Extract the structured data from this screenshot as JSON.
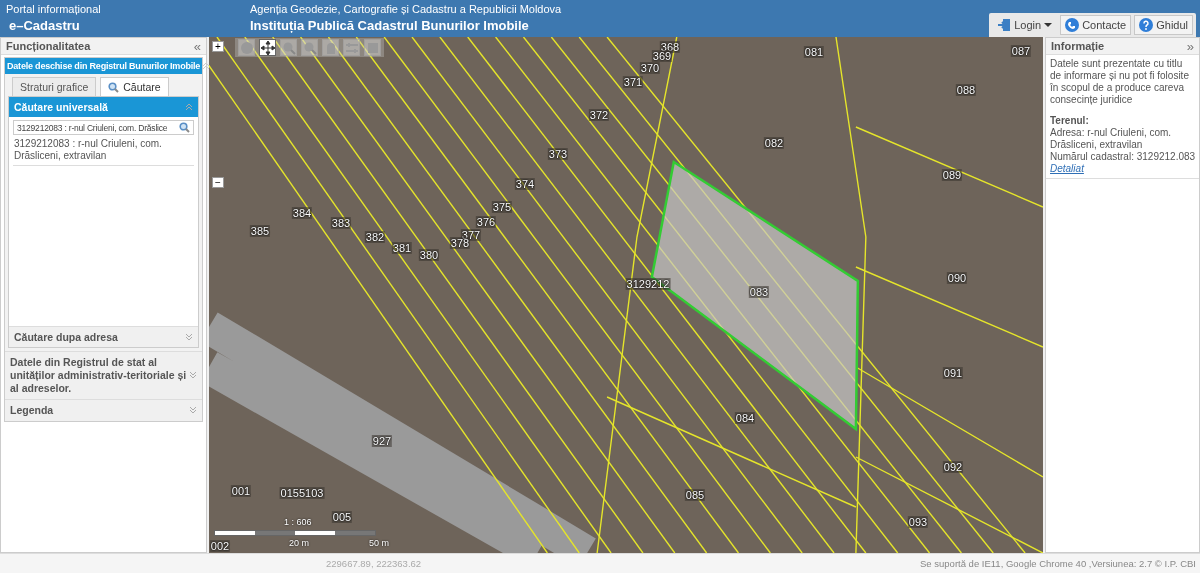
{
  "header": {
    "portal": "Portal informațional",
    "app_name": "e–Cadastru",
    "agency": "Agenția Geodezie, Cartografie și Cadastru a Republicii Moldova",
    "institution": "Instituția Publică Cadastrul Bunurilor Imobile"
  },
  "top_buttons": [
    {
      "label": "Login",
      "kind": "login"
    },
    {
      "label": "Contacte",
      "kind": "contact"
    },
    {
      "label": "Ghidul",
      "kind": "help"
    }
  ],
  "sidebar": {
    "title": "Funcționalitatea",
    "collapse": "«",
    "panel": {
      "title": "Datele deschise din Registrul Bunurilor Imobile",
      "expanded": true,
      "tabs": [
        {
          "label": "Straturi grafice",
          "selected": false
        },
        {
          "label": "Căutare",
          "selected": true
        }
      ],
      "sections": [
        {
          "title": "Căutare universală",
          "expanded": true,
          "search_value": "3129212083 : r-nul Criuleni, com. Drăslice",
          "results": [
            "3129212083 : r-nul Criuleni, com. Drăsliceni, extravilan"
          ]
        },
        {
          "title": "Căutare dupa adresa",
          "expanded": false
        }
      ]
    },
    "other_panels": [
      {
        "title": "Datele din Registrul de stat al unităților administrativ-teritoriale și al adreselor.",
        "expanded": false
      },
      {
        "title": "Legenda",
        "expanded": false
      }
    ]
  },
  "map": {
    "zoom_in": "+",
    "zoom_out": "−",
    "tools": [
      {
        "kind": "globe",
        "selected": false
      },
      {
        "kind": "pan",
        "selected": true
      },
      {
        "kind": "zoomin",
        "selected": false
      },
      {
        "kind": "zoomout",
        "selected": false
      },
      {
        "kind": "info",
        "selected": false
      },
      {
        "kind": "measure",
        "selected": false
      },
      {
        "kind": "print",
        "selected": false
      }
    ],
    "parcel_labels": [
      "368",
      "369",
      "370",
      "371",
      "372",
      "373",
      "374",
      "375",
      "376",
      "377",
      "378",
      "380",
      "381",
      "382",
      "383",
      "384",
      "385",
      "081",
      "087",
      "088",
      "082",
      "089",
      "083",
      "090",
      "091",
      "084",
      "092",
      "085",
      "093",
      "927",
      "001",
      "002",
      "005",
      "3129212",
      "0155103"
    ],
    "scale": {
      "ratio": "1 : 606",
      "mid": "20 m",
      "end": "50 m"
    }
  },
  "info_panel": {
    "title": "Informație",
    "collapse": "»",
    "notice": "Datele sunt prezentate cu titlu de informare și nu pot fi folosite în scopul de a produce careva consecințe juridice",
    "section_title": "Terenul:",
    "address": "Adresa: r-nul Criuleni, com. Drăsliceni, extravilan",
    "cadastral": "Numărul cadastral: 3129212.083",
    "details_link": "Detaliat"
  },
  "status_bar": {
    "coordinates": "229667.89, 222363.62",
    "support": "Se suportă de IE11, Google Chrome 40 ,Versiunea: 2.7 © I.P. CBI"
  }
}
